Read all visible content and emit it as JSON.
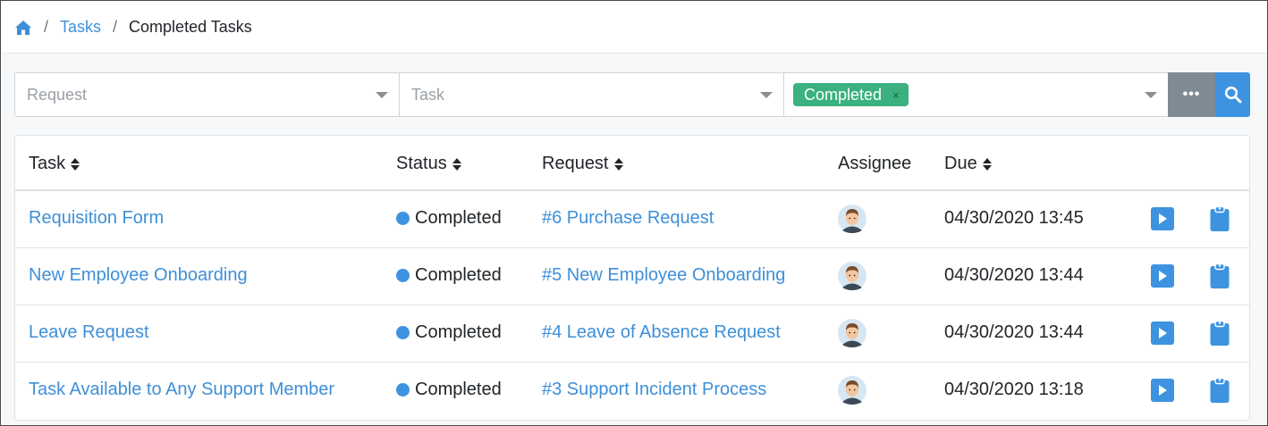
{
  "breadcrumb": {
    "home_icon": "home-icon",
    "separator": "/",
    "tasks_label": "Tasks",
    "current_label": "Completed Tasks"
  },
  "filters": {
    "request_placeholder": "Request",
    "task_placeholder": "Task",
    "status_chip": "Completed",
    "status_chip_remove": "×",
    "more_label": "•••",
    "search_icon": "search-icon"
  },
  "table": {
    "columns": {
      "task": "Task",
      "status": "Status",
      "request": "Request",
      "assignee": "Assignee",
      "due": "Due"
    },
    "rows": [
      {
        "task": "Requisition Form",
        "status": "Completed",
        "request": "#6 Purchase Request",
        "due": "04/30/2020 13:45"
      },
      {
        "task": "New Employee Onboarding",
        "status": "Completed",
        "request": "#5 New Employee Onboarding",
        "due": "04/30/2020 13:44"
      },
      {
        "task": "Leave Request",
        "status": "Completed",
        "request": "#4 Leave of Absence Request",
        "due": "04/30/2020 13:44"
      },
      {
        "task": "Task Available to Any Support Member",
        "status": "Completed",
        "request": "#3 Support Incident Process",
        "due": "04/30/2020 13:18"
      }
    ]
  },
  "colors": {
    "link": "#3e8fd8",
    "chip": "#3bb180",
    "status_dot": "#3d93e0",
    "more_button": "#7f8a94",
    "search_button": "#3d93e0"
  }
}
